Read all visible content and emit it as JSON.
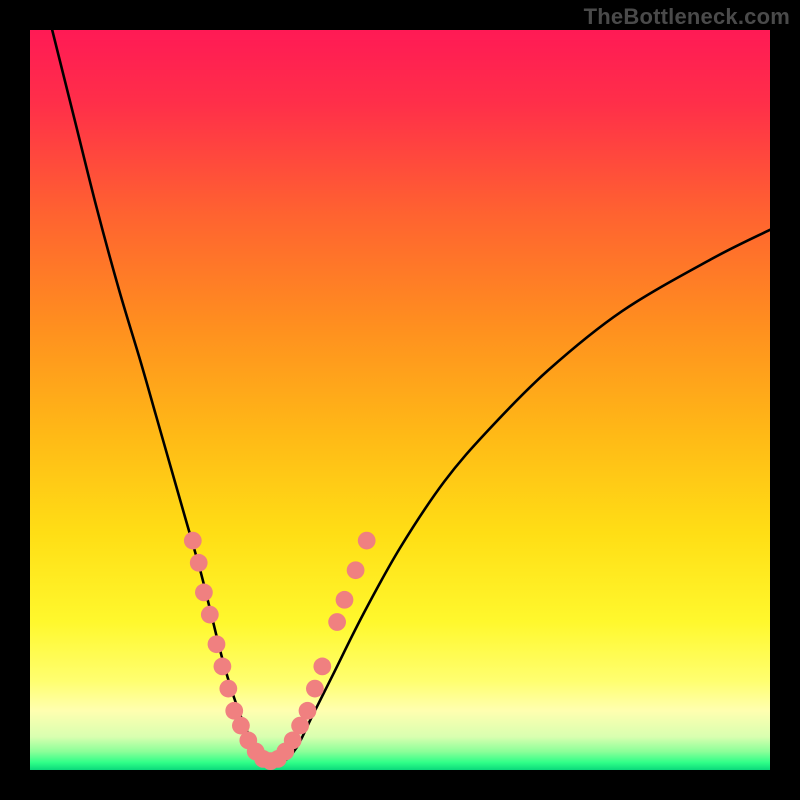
{
  "watermark": "TheBottleneck.com",
  "gradient_stops": [
    {
      "offset": 0.0,
      "color": "#ff1a55"
    },
    {
      "offset": 0.1,
      "color": "#ff2f49"
    },
    {
      "offset": 0.25,
      "color": "#ff6330"
    },
    {
      "offset": 0.4,
      "color": "#ff8f1f"
    },
    {
      "offset": 0.55,
      "color": "#ffba16"
    },
    {
      "offset": 0.68,
      "color": "#ffde15"
    },
    {
      "offset": 0.8,
      "color": "#fff82d"
    },
    {
      "offset": 0.88,
      "color": "#ffff70"
    },
    {
      "offset": 0.92,
      "color": "#ffffb0"
    },
    {
      "offset": 0.955,
      "color": "#d9ffb0"
    },
    {
      "offset": 0.975,
      "color": "#8cff99"
    },
    {
      "offset": 0.99,
      "color": "#2fff88"
    },
    {
      "offset": 1.0,
      "color": "#0bd97b"
    }
  ],
  "chart_data": {
    "type": "line",
    "title": "",
    "xlabel": "",
    "ylabel": "",
    "xlim": [
      0,
      100
    ],
    "ylim": [
      0,
      100
    ],
    "series": [
      {
        "name": "bottleneck-curve",
        "x": [
          3,
          6,
          9,
          12,
          15,
          17,
          19,
          21,
          23,
          24.5,
          26,
          27.5,
          29,
          30.5,
          32,
          34,
          36,
          38,
          41,
          45,
          50,
          56,
          62,
          70,
          80,
          92,
          100
        ],
        "y": [
          100,
          88,
          76,
          65,
          55,
          48,
          41,
          34,
          27,
          21,
          15,
          10,
          6,
          3,
          1,
          1,
          3,
          7,
          13,
          21,
          30,
          39,
          46,
          54,
          62,
          69,
          73
        ]
      }
    ],
    "markers": {
      "name": "highlight-dots",
      "color": "#f08080",
      "radius_plot_units": 1.2,
      "points": [
        {
          "x": 22.0,
          "y": 31
        },
        {
          "x": 22.8,
          "y": 28
        },
        {
          "x": 23.5,
          "y": 24
        },
        {
          "x": 24.3,
          "y": 21
        },
        {
          "x": 25.2,
          "y": 17
        },
        {
          "x": 26.0,
          "y": 14
        },
        {
          "x": 26.8,
          "y": 11
        },
        {
          "x": 27.6,
          "y": 8
        },
        {
          "x": 28.5,
          "y": 6
        },
        {
          "x": 29.5,
          "y": 4
        },
        {
          "x": 30.5,
          "y": 2.5
        },
        {
          "x": 31.5,
          "y": 1.5
        },
        {
          "x": 32.5,
          "y": 1.2
        },
        {
          "x": 33.5,
          "y": 1.5
        },
        {
          "x": 34.5,
          "y": 2.5
        },
        {
          "x": 35.5,
          "y": 4
        },
        {
          "x": 36.5,
          "y": 6
        },
        {
          "x": 37.5,
          "y": 8
        },
        {
          "x": 38.5,
          "y": 11
        },
        {
          "x": 39.5,
          "y": 14
        },
        {
          "x": 41.5,
          "y": 20
        },
        {
          "x": 42.5,
          "y": 23
        },
        {
          "x": 44.0,
          "y": 27
        },
        {
          "x": 45.5,
          "y": 31
        }
      ]
    }
  }
}
